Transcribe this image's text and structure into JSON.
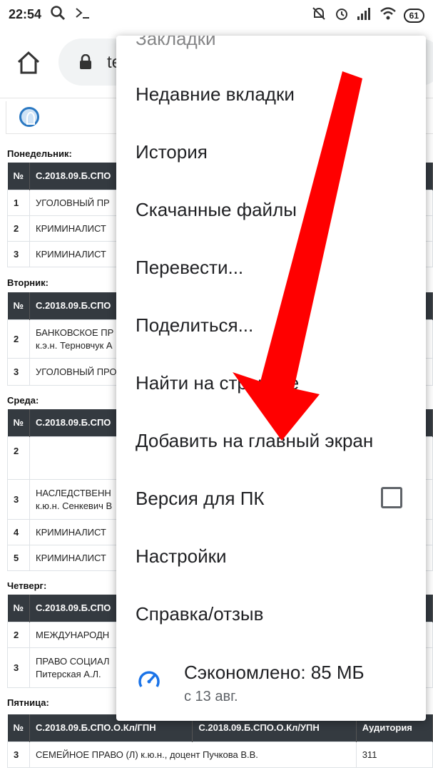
{
  "status_bar": {
    "time": "22:54",
    "left_icons": [
      "search-icon",
      "terminal-icon"
    ],
    "right_icons": [
      "alarm-off-icon",
      "alarm-icon",
      "signal-icon",
      "wifi-icon"
    ],
    "battery": "61"
  },
  "toolbar": {
    "url": "te",
    "icons": [
      "home-icon",
      "lock-icon"
    ]
  },
  "days": [
    {
      "name": "Понедельник:",
      "headers": [
        "№",
        "С.2018.09.Б.СПО"
      ],
      "rows": [
        {
          "n": "1",
          "text": "УГОЛОВНЫЙ ПР",
          "sub": ""
        },
        {
          "n": "2",
          "text": "КРИМИНАЛИСТ",
          "sub": ""
        },
        {
          "n": "3",
          "text": "КРИМИНАЛИСТ",
          "sub": ""
        }
      ]
    },
    {
      "name": "Вторник:",
      "headers": [
        "№",
        "С.2018.09.Б.СПО"
      ],
      "rows": [
        {
          "n": "2",
          "text": "БАНКОВСКОЕ ПР",
          "sub": "к.э.н. Терновчук А"
        },
        {
          "n": "3",
          "text": "УГОЛОВНЫЙ ПРО",
          "sub": ""
        }
      ]
    },
    {
      "name": "Среда:",
      "headers": [
        "№",
        "С.2018.09.Б.СПО"
      ],
      "rows": [
        {
          "n": "2",
          "text": "",
          "sub": ""
        },
        {
          "n": "3",
          "text": "НАСЛЕДСТВЕНН",
          "sub": "к.ю.н. Сенкевич В"
        },
        {
          "n": "4",
          "text": "КРИМИНАЛИСТ",
          "sub": ""
        },
        {
          "n": "5",
          "text": "КРИМИНАЛИСТ",
          "sub": ""
        }
      ]
    },
    {
      "name": "Четверг:",
      "headers": [
        "№",
        "С.2018.09.Б.СПО"
      ],
      "rows": [
        {
          "n": "2",
          "text": "МЕЖДУНАРОДН",
          "sub": ""
        },
        {
          "n": "3",
          "text": "ПРАВО СОЦИАЛ",
          "sub": "Питерская А.Л."
        }
      ]
    },
    {
      "name": "Пятница:",
      "headers": [
        "№",
        "С.2018.09.Б.СПО.О.Кл/ГПН",
        "С.2018.09.Б.СПО.О.Кл/УПН",
        "Аудитория"
      ],
      "rows": [
        {
          "n": "3",
          "text": "СЕМЕЙНОЕ ПРАВО (Л) к.ю.н., доцент Пучкова В.В.",
          "sub": "",
          "room": "311"
        }
      ]
    }
  ],
  "menu": {
    "cut_item": "Закладки",
    "items": [
      "Недавние вкладки",
      "История",
      "Скачанные файлы",
      "Перевести...",
      "Поделиться...",
      "Найти на странице",
      "Добавить на главный экран",
      "Версия для ПК",
      "Настройки",
      "Справка/отзыв"
    ],
    "desktop_checked": false,
    "saved_title": "Сэкономлено: 85 МБ",
    "saved_since": "с 13 авг.",
    "accent": "#1a73e8"
  },
  "annotation": {
    "arrow_color": "#ff0000"
  }
}
